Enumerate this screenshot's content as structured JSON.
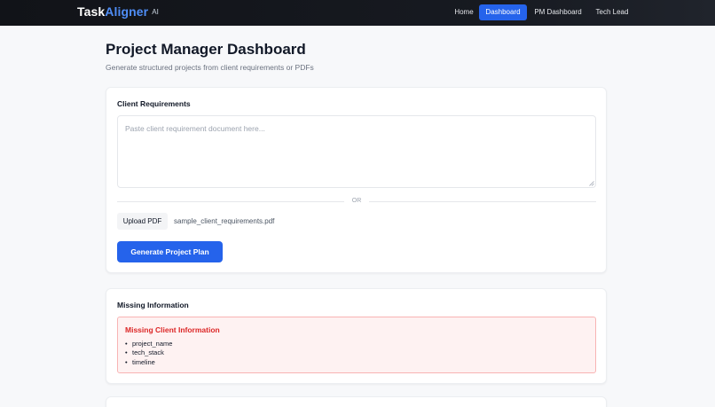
{
  "app": {
    "brand_primary": "Task",
    "brand_accent": "Aligner",
    "brand_suffix": "AI",
    "accent_color": "#2563eb"
  },
  "nav": {
    "items": [
      {
        "label": "Home",
        "active": false
      },
      {
        "label": "Dashboard",
        "active": true
      },
      {
        "label": "PM Dashboard",
        "active": false
      },
      {
        "label": "Tech Lead",
        "active": false
      }
    ]
  },
  "page": {
    "title": "Project Manager Dashboard",
    "subtitle": "Generate structured projects from client requirements or PDFs"
  },
  "requirements": {
    "title": "Client Requirements",
    "textarea_value": "",
    "textarea_placeholder": "Paste client requirement document here...",
    "or_label": "OR",
    "upload_label": "Upload PDF",
    "file_name": "sample_client_requirements.pdf",
    "generate_label": "Generate Project Plan"
  },
  "missing": {
    "title": "Missing Information",
    "alert_title": "Missing Client Information",
    "alert_color": "#dc2626",
    "items": [
      "project_name",
      "tech_stack",
      "timeline"
    ]
  }
}
